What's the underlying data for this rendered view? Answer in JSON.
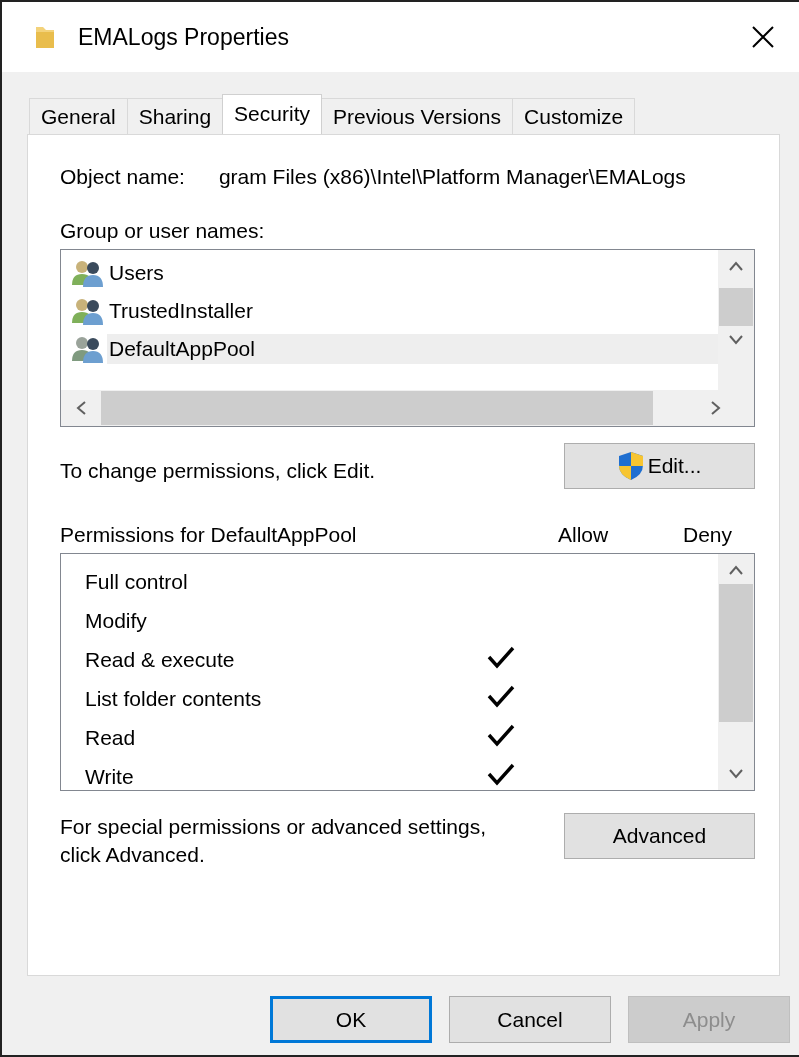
{
  "window": {
    "title": "EMALogs Properties"
  },
  "tabs": [
    {
      "label": "General",
      "selected": false
    },
    {
      "label": "Sharing",
      "selected": false
    },
    {
      "label": "Security",
      "selected": true
    },
    {
      "label": "Previous Versions",
      "selected": false
    },
    {
      "label": "Customize",
      "selected": false
    }
  ],
  "object_name": {
    "label": "Object name:",
    "value": "gram Files (x86)\\Intel\\Platform Manager\\EMALogs"
  },
  "groups": {
    "label": "Group or user names:",
    "items": [
      {
        "name": "Users",
        "selected": false
      },
      {
        "name": "TrustedInstaller",
        "selected": false
      },
      {
        "name": "DefaultAppPool",
        "selected": true
      }
    ]
  },
  "change_hint": "To change permissions, click Edit.",
  "edit_button": "Edit...",
  "permissions": {
    "label": "Permissions for DefaultAppPool",
    "allow_header": "Allow",
    "deny_header": "Deny",
    "items": [
      {
        "name": "Full control",
        "allow": false
      },
      {
        "name": "Modify",
        "allow": false
      },
      {
        "name": "Read & execute",
        "allow": true
      },
      {
        "name": "List folder contents",
        "allow": true
      },
      {
        "name": "Read",
        "allow": true
      },
      {
        "name": "Write",
        "allow": true
      }
    ]
  },
  "advanced_hint": "For special permissions or advanced settings, click Advanced.",
  "advanced_button": "Advanced",
  "buttons": [
    {
      "label": "OK",
      "kind": "default",
      "disabled": false
    },
    {
      "label": "Cancel",
      "kind": "normal",
      "disabled": false
    },
    {
      "label": "Apply",
      "kind": "normal",
      "disabled": true
    }
  ]
}
